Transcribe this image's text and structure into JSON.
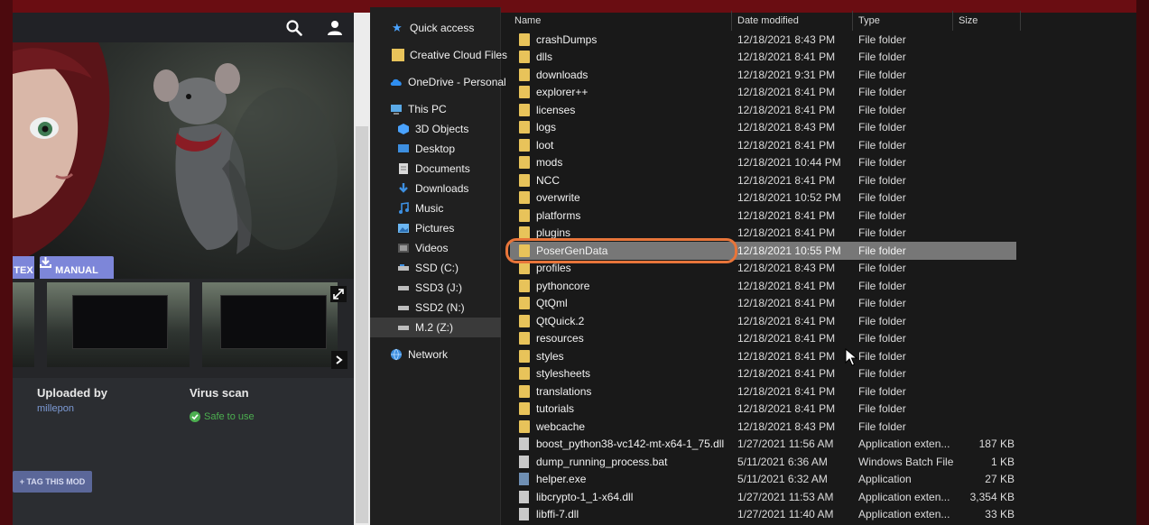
{
  "website": {
    "buttons": {
      "tex_label": "TEX",
      "manual_label": "MANUAL",
      "tag_label": "+ TAG THIS MOD"
    },
    "uploaded_by": {
      "label": "Uploaded by",
      "value": "millepon"
    },
    "virus_scan": {
      "label": "Virus scan",
      "value": "Safe to use"
    },
    "colors": {
      "button": "#7d86d9",
      "safe": "#4caf50",
      "link": "#7d9bd6"
    }
  },
  "explorer": {
    "nav": [
      {
        "label": "Quick access",
        "icon": "star-icon"
      },
      {
        "label": "Creative Cloud Files",
        "icon": "creative-cloud-icon"
      },
      {
        "label": "OneDrive - Personal",
        "icon": "cloud-icon"
      },
      {
        "label": "This PC",
        "icon": "computer-icon"
      },
      {
        "label": "3D Objects",
        "icon": "cube-icon"
      },
      {
        "label": "Desktop",
        "icon": "desktop-icon"
      },
      {
        "label": "Documents",
        "icon": "document-icon"
      },
      {
        "label": "Downloads",
        "icon": "download-icon"
      },
      {
        "label": "Music",
        "icon": "music-icon"
      },
      {
        "label": "Pictures",
        "icon": "picture-icon"
      },
      {
        "label": "Videos",
        "icon": "video-icon"
      },
      {
        "label": "SSD (C:)",
        "icon": "drive-icon"
      },
      {
        "label": "SSD3 (J:)",
        "icon": "drive-icon"
      },
      {
        "label": "SSD2 (N:)",
        "icon": "drive-icon"
      },
      {
        "label": "M.2 (Z:)",
        "icon": "drive-icon"
      },
      {
        "label": "Network",
        "icon": "network-icon"
      }
    ],
    "columns": {
      "name": "Name",
      "date": "Date modified",
      "type": "Type",
      "size": "Size"
    },
    "files": [
      {
        "name": "crashDumps",
        "date": "12/18/2021 8:43 PM",
        "type": "File folder",
        "size": "",
        "kind": "folder"
      },
      {
        "name": "dlls",
        "date": "12/18/2021 8:41 PM",
        "type": "File folder",
        "size": "",
        "kind": "folder"
      },
      {
        "name": "downloads",
        "date": "12/18/2021 9:31 PM",
        "type": "File folder",
        "size": "",
        "kind": "folder"
      },
      {
        "name": "explorer++",
        "date": "12/18/2021 8:41 PM",
        "type": "File folder",
        "size": "",
        "kind": "folder"
      },
      {
        "name": "licenses",
        "date": "12/18/2021 8:41 PM",
        "type": "File folder",
        "size": "",
        "kind": "folder"
      },
      {
        "name": "logs",
        "date": "12/18/2021 8:43 PM",
        "type": "File folder",
        "size": "",
        "kind": "folder"
      },
      {
        "name": "loot",
        "date": "12/18/2021 8:41 PM",
        "type": "File folder",
        "size": "",
        "kind": "folder"
      },
      {
        "name": "mods",
        "date": "12/18/2021 10:44 PM",
        "type": "File folder",
        "size": "",
        "kind": "folder"
      },
      {
        "name": "NCC",
        "date": "12/18/2021 8:41 PM",
        "type": "File folder",
        "size": "",
        "kind": "folder"
      },
      {
        "name": "overwrite",
        "date": "12/18/2021 10:52 PM",
        "type": "File folder",
        "size": "",
        "kind": "folder"
      },
      {
        "name": "platforms",
        "date": "12/18/2021 8:41 PM",
        "type": "File folder",
        "size": "",
        "kind": "folder"
      },
      {
        "name": "plugins",
        "date": "12/18/2021 8:41 PM",
        "type": "File folder",
        "size": "",
        "kind": "folder"
      },
      {
        "name": "PoserGenData",
        "date": "12/18/2021 10:55 PM",
        "type": "File folder",
        "size": "",
        "kind": "folder",
        "selected": true
      },
      {
        "name": "profiles",
        "date": "12/18/2021 8:43 PM",
        "type": "File folder",
        "size": "",
        "kind": "folder"
      },
      {
        "name": "pythoncore",
        "date": "12/18/2021 8:41 PM",
        "type": "File folder",
        "size": "",
        "kind": "folder"
      },
      {
        "name": "QtQml",
        "date": "12/18/2021 8:41 PM",
        "type": "File folder",
        "size": "",
        "kind": "folder"
      },
      {
        "name": "QtQuick.2",
        "date": "12/18/2021 8:41 PM",
        "type": "File folder",
        "size": "",
        "kind": "folder"
      },
      {
        "name": "resources",
        "date": "12/18/2021 8:41 PM",
        "type": "File folder",
        "size": "",
        "kind": "folder"
      },
      {
        "name": "styles",
        "date": "12/18/2021 8:41 PM",
        "type": "File folder",
        "size": "",
        "kind": "folder"
      },
      {
        "name": "stylesheets",
        "date": "12/18/2021 8:41 PM",
        "type": "File folder",
        "size": "",
        "kind": "folder"
      },
      {
        "name": "translations",
        "date": "12/18/2021 8:41 PM",
        "type": "File folder",
        "size": "",
        "kind": "folder"
      },
      {
        "name": "tutorials",
        "date": "12/18/2021 8:41 PM",
        "type": "File folder",
        "size": "",
        "kind": "folder"
      },
      {
        "name": "webcache",
        "date": "12/18/2021 8:43 PM",
        "type": "File folder",
        "size": "",
        "kind": "folder"
      },
      {
        "name": "boost_python38-vc142-mt-x64-1_75.dll",
        "date": "1/27/2021 11:56 AM",
        "type": "Application exten...",
        "size": "187 KB",
        "kind": "dll"
      },
      {
        "name": "dump_running_process.bat",
        "date": "5/11/2021 6:36 AM",
        "type": "Windows Batch File",
        "size": "1 KB",
        "kind": "bat"
      },
      {
        "name": "helper.exe",
        "date": "5/11/2021 6:32 AM",
        "type": "Application",
        "size": "27 KB",
        "kind": "exe"
      },
      {
        "name": "libcrypto-1_1-x64.dll",
        "date": "1/27/2021 11:53 AM",
        "type": "Application exten...",
        "size": "3,354 KB",
        "kind": "dll"
      },
      {
        "name": "libffi-7.dll",
        "date": "1/27/2021 11:40 AM",
        "type": "Application exten...",
        "size": "33 KB",
        "kind": "dll"
      }
    ],
    "colors": {
      "folder": "#e8c35a",
      "selected_row": "#777777",
      "highlight": "#e8753a"
    }
  }
}
